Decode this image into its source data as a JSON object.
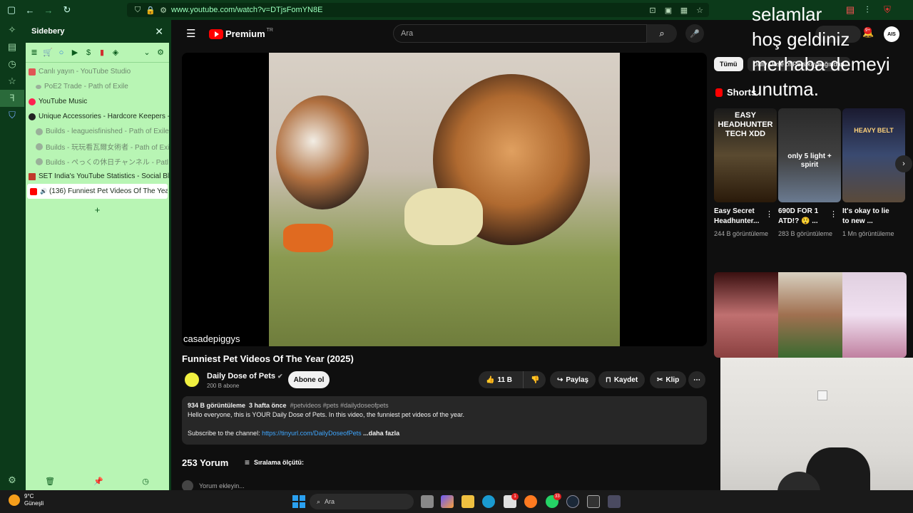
{
  "browser": {
    "url": "www.youtube.com/watch?v=DTjsFomYN8E"
  },
  "sidebery": {
    "title": "Sidebery",
    "panel_badges": [
      "2",
      "2",
      "0",
      "6",
      "0",
      "1",
      "6"
    ],
    "tabs": [
      {
        "label": "Canlı yayın - YouTube Studio",
        "style": "dim",
        "fav": "#e05555"
      },
      {
        "label": "PoE2 Trade - Path of Exile",
        "style": "child",
        "fav": "#9ab09a"
      },
      {
        "label": "YouTube Music",
        "style": "",
        "fav": "#ff2050"
      },
      {
        "label": "Unique Accessories - Hardcore Keepers -",
        "style": "",
        "fav": "#222222"
      },
      {
        "label": "Builds - leagueisfinished - Path of Exile",
        "style": "child",
        "fav": "#9ab09a"
      },
      {
        "label": "Builds - 玩玩看瓦爾女術者 - Path of Exi",
        "style": "child",
        "fav": "#9ab09a"
      },
      {
        "label": "Builds - ぺっくの休日チャンネル - Patl",
        "style": "child",
        "fav": "#9ab09a"
      },
      {
        "label": "SET India's YouTube Statistics - Social Bla",
        "style": "",
        "fav": "#c0392b"
      },
      {
        "label": "(136) Funniest Pet Videos Of The Year",
        "style": "active",
        "fav": "#ff0000"
      }
    ],
    "new_tab": "+"
  },
  "youtube": {
    "logo_text": "Premium",
    "logo_region": "TR",
    "search_placeholder": "Ara",
    "video_overlay_text": "casadepiggys",
    "title": "Funniest Pet Videos Of The Year (2025)",
    "channel": "Daily Dose of Pets",
    "subscribers": "200 B abone",
    "subscribe_label": "Abone ol",
    "likes": "11 B",
    "share_label": "Paylaş",
    "save_label": "Kaydet",
    "clip_label": "Klip",
    "description": {
      "views": "934 B görüntüleme",
      "time": "3 hafta önce",
      "tags": "#petvideos #pets #dailydoseofpets",
      "line1": "Hello everyone, this is YOUR Daily Dose of Pets. In this video, the funniest pet videos of the year.",
      "line2_prefix": "Subscribe to the channel: ",
      "link": "https://tinyurl.com/DailyDoseofPets",
      "more": "...daha fazla"
    },
    "comments_count": "253 Yorum",
    "sort_label": "Sıralama ölçütü:",
    "add_comment": "Yorum ekleyin...",
    "notif_badge": "9+",
    "chip_all": "Tümü",
    "chip_partial": "Daily Dose of Pets kaynağından",
    "shorts_title": "Shorts",
    "shorts": [
      {
        "title": "Easy Secret Headhunter...",
        "views": "244 B görüntüleme",
        "thumb_text": "EASY HEADHUNTER TECH XDD"
      },
      {
        "title": "690D FOR 1 ATD!? 😲 ...",
        "views": "283 B görüntüleme",
        "thumb_text": "only 5 light + spirit"
      },
      {
        "title": "It's okay to lie to new ...",
        "views": "1 Mn görüntüleme",
        "thumb_text": "HEAVY BELT"
      }
    ]
  },
  "overlay_text": "selamlar\nhoş geldiniz\nmerhaba demeyi\nunutma.",
  "taskbar": {
    "temperature": "9°C",
    "weather": "Güneşli",
    "search": "Ara",
    "badges": [
      "1",
      "33"
    ]
  },
  "colors": {
    "sidebery_bg": "#b8f5b4",
    "chrome_bg": "#0c3a1a",
    "yt_red": "#ff0000",
    "link": "#3ea6ff"
  }
}
